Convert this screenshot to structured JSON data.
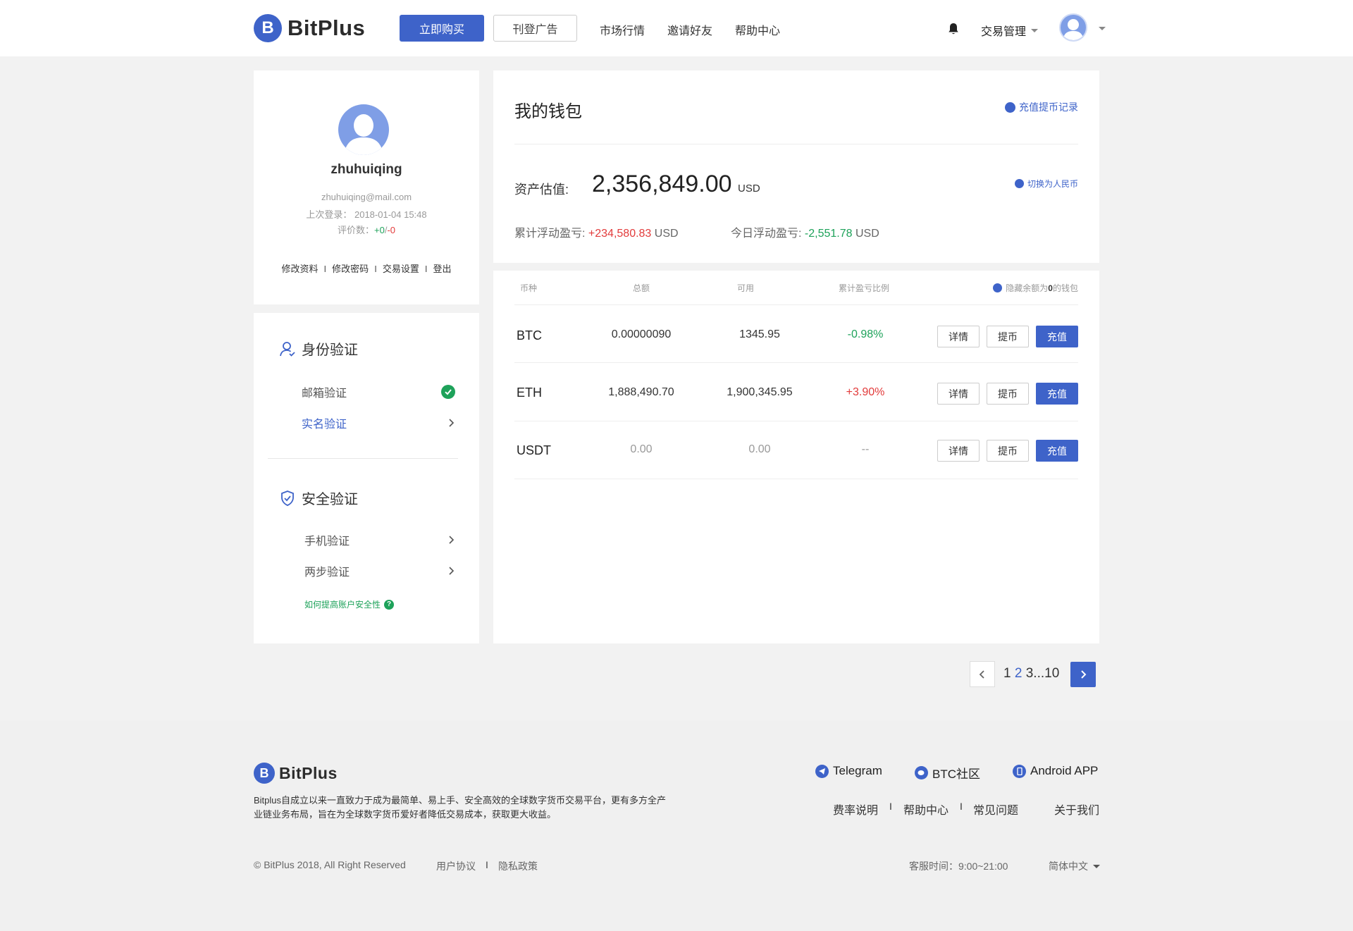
{
  "header": {
    "logo_mark": "B",
    "logo_text": "BitPlus",
    "buy_button": "立即购买",
    "ad_button": "刊登广告",
    "nav": [
      "市场行情",
      "邀请好友",
      "帮助中心"
    ],
    "trade_mgmt": "交易管理"
  },
  "profile": {
    "username": "zhuhuiqing",
    "email": "zhuhuiqing@mail.com",
    "last_login_label": "上次登录：",
    "last_login": "2018-01-04 15:48",
    "rating_label": "评价数：",
    "rating_pos": "+0",
    "rating_slash": "/",
    "rating_neg": "-0",
    "links": [
      "修改资料",
      "修改密码",
      "交易设置",
      "登出"
    ],
    "link_sep": "I"
  },
  "verification": {
    "identity_title": "身份验证",
    "email_verify": "邮箱验证",
    "realname_verify": "实名验证",
    "security_title": "安全验证",
    "phone_verify": "手机验证",
    "twostep_verify": "两步验证",
    "help_link": "如何提高账户安全性",
    "help_icon": "?"
  },
  "wallet": {
    "title": "我的钱包",
    "history_link": "充值提币记录",
    "asset_label": "资产估值:",
    "asset_value": "2,356,849.00",
    "asset_unit": "USD",
    "switch_link": "切换为人民币",
    "total_pnl_label": "累计浮动盈亏:",
    "total_pnl_value": "+234,580.83",
    "total_pnl_unit": "USD",
    "today_pnl_label": "今日浮动盈亏:",
    "today_pnl_value": "-2,551.78",
    "today_pnl_unit": "USD"
  },
  "table": {
    "headers": [
      "币种",
      "总额",
      "可用",
      "累计盈亏比例"
    ],
    "hide_zero_prefix": "隐藏余额为",
    "hide_zero_bold": "0",
    "hide_zero_suffix": "的钱包",
    "rows": [
      {
        "coin": "BTC",
        "total": "0.00000090",
        "available": "1345.95",
        "ratio": "-0.98%"
      },
      {
        "coin": "ETH",
        "total": "1,888,490.70",
        "available": "1,900,345.95",
        "ratio": "+3.90%"
      },
      {
        "coin": "USDT",
        "total": "0.00",
        "available": "0.00",
        "ratio": "--"
      }
    ],
    "actions": [
      "详情",
      "提币",
      "充值"
    ]
  },
  "pagination": {
    "page1": "1",
    "page2": "2",
    "rest": "3...10"
  },
  "footer": {
    "logo_mark": "B",
    "logo_text": "BitPlus",
    "description": "Bitplus自成立以来一直致力于成为最简单、易上手、安全高效的全球数字货币交易平台，更有多方全产业链业务布局，旨在为全球数字货币爱好者降低交易成本，获取更大收益。",
    "social": [
      "Telegram",
      "BTC社区",
      "Android APP"
    ],
    "links": [
      "费率说明",
      "帮助中心",
      "常见问题",
      "关于我们"
    ],
    "link_sep": "I",
    "copyright": "© BitPlus 2018, All Right Reserved",
    "legal": [
      "用户协议",
      "隐私政策"
    ],
    "service": "客服时间：9:00~21:00",
    "language": "简体中文"
  },
  "colors": {
    "brand": "#3e63c9",
    "green": "#1ea25a",
    "red": "#e23b3b"
  }
}
